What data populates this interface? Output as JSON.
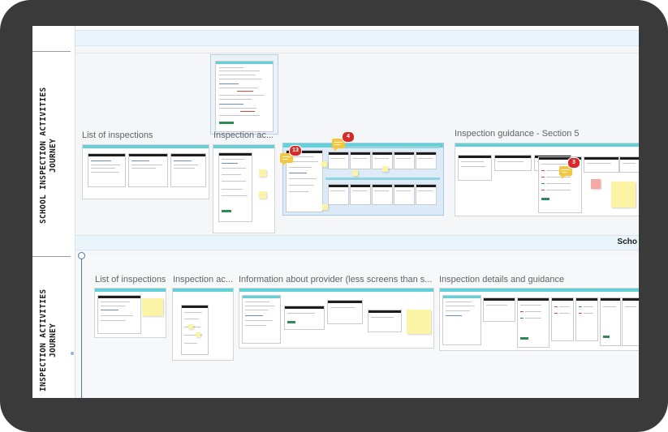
{
  "lanes": {
    "lane1_label": "SCHOOL INSPECTION ACTIVITIES\nJOURNEY",
    "lane2_label": "INSPECTION ACTIVITIES\nJOURNEY",
    "divider_band_title": "Scho"
  },
  "lane1_frames": [
    {
      "title": "List of inspections"
    },
    {
      "title": "Inspection ac..."
    },
    {
      "title": "Inspection guidance - Section 5"
    }
  ],
  "lane2_frames": [
    {
      "title": "List of inspections"
    },
    {
      "title": "Inspection ac..."
    },
    {
      "title": "Information about provider (less screens than s..."
    },
    {
      "title": "Inspection details and guidance"
    }
  ],
  "comment_badges": {
    "badge_a": "13",
    "badge_b": "4",
    "badge_c": "3"
  },
  "colors": {
    "frame_header": "#62d2d8",
    "sticky_yellow": "#fbf3a6",
    "sticky_pink": "#f4a9a6",
    "comment_yellow": "#f6c63c",
    "badge_red": "#d72b2b",
    "lane_band": "#e9f4fb",
    "bezel": "#3a3a3a"
  },
  "icons": [
    "comment-icon",
    "notification-badge",
    "lane-connector-dot"
  ]
}
